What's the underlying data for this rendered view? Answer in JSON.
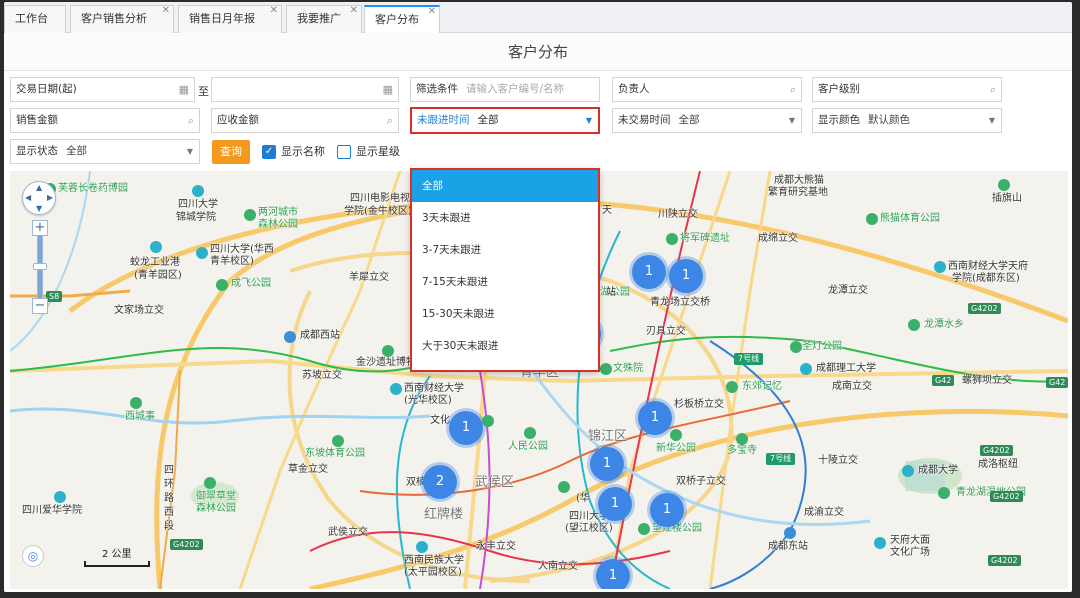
{
  "tabs": [
    {
      "label": "工作台",
      "closable": false
    },
    {
      "label": "客户销售分析",
      "closable": true
    },
    {
      "label": "销售日月年报",
      "closable": true
    },
    {
      "label": "我要推广",
      "closable": true
    },
    {
      "label": "客户分布",
      "closable": true,
      "active": true
    }
  ],
  "page_title": "客户分布",
  "filters": {
    "date_start_label": "交易日期(起)",
    "to_label": "至",
    "condition_label": "筛选条件",
    "condition_placeholder": "请输入客户编号/名称",
    "owner_label": "负责人",
    "level_label": "客户级别",
    "sales_amount_label": "销售金额",
    "receivable_label": "应收金额",
    "no_followup_label": "未跟进时间",
    "no_followup_value": "全部",
    "no_trade_label": "未交易时间",
    "no_trade_value": "全部",
    "display_color_label": "显示颜色",
    "display_color_value": "默认颜色",
    "display_state_label": "显示状态",
    "display_state_value": "全部",
    "query_button": "查询",
    "show_name_label": "显示名称",
    "show_name_checked": true,
    "show_star_label": "显示星级",
    "show_star_checked": false
  },
  "dropdown": {
    "options": [
      "全部",
      "3天未跟进",
      "3-7天未跟进",
      "7-15天未跟进",
      "15-30天未跟进",
      "大于30天未跟进"
    ],
    "selected": "全部"
  },
  "map": {
    "scale_label": "2 公里",
    "clusters": [
      "1",
      "1",
      "1",
      "1",
      "2",
      "1",
      "1",
      "1",
      "1",
      "1"
    ],
    "labels": {
      "l1": "芙蓉长卷药博园",
      "l2": "四川大学",
      "l3": "锦城学院",
      "l4": "两河城市",
      "l5": "森林公园",
      "l6": "四川电影电视",
      "l7": "学院(金牛校区)",
      "l8": "蛟龙工业港",
      "l9": "(青羊园区)",
      "l10": "四川大学(华西",
      "l11": "青羊校区)",
      "l12": "成飞公园",
      "l13": "文家场立交",
      "l14": "羊犀立交",
      "l15": "成都西站",
      "l16": "金沙遗址博物馆",
      "l17": "苏坡立交",
      "l18": "西南财经大学",
      "l19": "(光华校区)",
      "l20": "西城事",
      "l21": "东坡体育公园",
      "l22": "草金立交",
      "l23": "人民公园",
      "l24": "文殊院",
      "l25": "青羊区",
      "l26": "锦江区",
      "l27": "武侯区",
      "l28": "红牌楼",
      "l29": "四川爱华学院",
      "l30": "御翠草堂",
      "l31": "森林公园",
      "l32": "武侯立交",
      "l33": "西南民族大学",
      "l34": "(太平园校区)",
      "l35": "永丰立交",
      "l36": "人南立交",
      "l37": "四川大学",
      "l38": "(望江校区)",
      "l39": "望江楼公园",
      "l40": "双桥子立交",
      "l41": "杉板桥立交",
      "l42": "新华公园",
      "l43": "多宝寺",
      "l44": "东郊记忆",
      "l45": "成都理工大学",
      "l46": "成南立交",
      "l47": "十陵立交",
      "l48": "成都大学",
      "l49": "成洛枢纽",
      "l50": "青龙湖湿地公园",
      "l51": "成渝立交",
      "l52": "成都东站",
      "l53": "天府大面",
      "l54": "文化广场",
      "l55": "成都大熊猫",
      "l56": "繁育研究基地",
      "l57": "川陕立交",
      "l58": "将军碑遗址",
      "l59": "成绵立交",
      "l60": "熊猫体育公园",
      "l61": "插旗山",
      "l62": "西南财经大学天府",
      "l63": "学院(成都东区)",
      "l64": "青龙场立交桥",
      "l65": "龙潭立交",
      "l66": "刃具立交",
      "l67": "圣灯公园",
      "l68": "龙潭水乡",
      "l69": "螺狮坝立交",
      "l70": "四",
      "l71": "环",
      "l72": "路",
      "l73": "西",
      "l74": "段",
      "l75": "湖公园",
      "l76": "双楠",
      "l77": "文化",
      "l78": "(华",
      "l79": "天",
      "l80": "站"
    },
    "road_shields": [
      "G4202",
      "S8",
      "G4202",
      "G42",
      "G42",
      "G4202",
      "G4202",
      "G4202"
    ],
    "metro_tags": [
      "7号线",
      "7号线"
    ]
  }
}
